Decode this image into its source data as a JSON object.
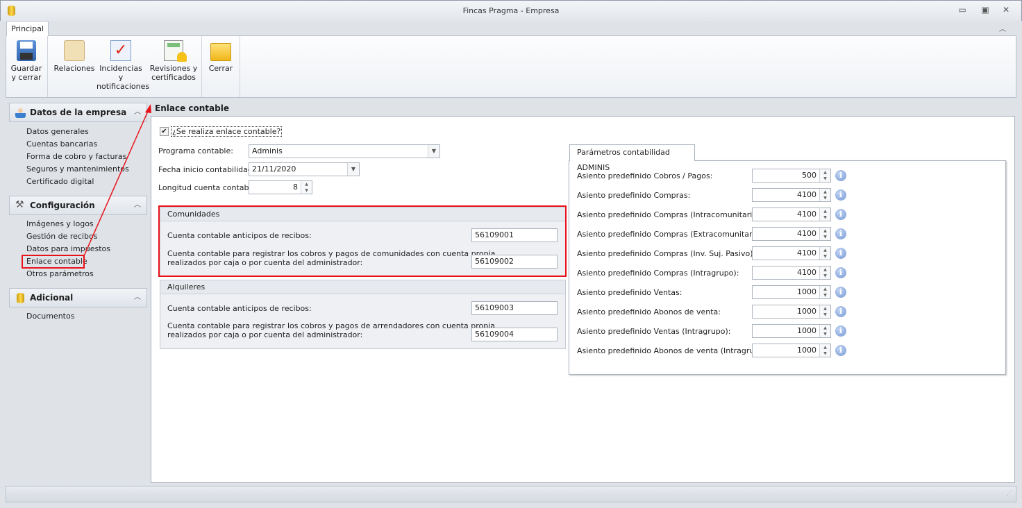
{
  "window": {
    "title": "Fincas Pragma - Empresa",
    "min": "▭",
    "max": "▣",
    "close": "✕",
    "collapse": "︿"
  },
  "ribbon": {
    "tab": "Principal",
    "buttons": [
      {
        "id": "guardar",
        "l1": "Guardar",
        "l2": "y cerrar",
        "icon": "floppy-disk-icon"
      },
      {
        "id": "relaciones",
        "l1": "Relaciones",
        "l2": "",
        "icon": "contact-cards-icon"
      },
      {
        "id": "incidencias",
        "l1": "Incidencias y",
        "l2": "notificaciones",
        "icon": "mail-check-icon"
      },
      {
        "id": "revisiones",
        "l1": "Revisiones y",
        "l2": "certificados",
        "icon": "notebook-bell-icon"
      },
      {
        "id": "cerrar",
        "l1": "Cerrar",
        "l2": "",
        "icon": "folder-arrow-icon"
      }
    ]
  },
  "sidebar": {
    "groups": [
      {
        "title": "Datos de la empresa",
        "items": [
          "Datos generales",
          "Cuentas bancarias",
          "Forma de cobro y facturas",
          "Seguros y mantenimientos",
          "Certificado digital"
        ]
      },
      {
        "title": "Configuración",
        "items": [
          "Imágenes y logos",
          "Gestión de recibos",
          "Datos para impuestos",
          "Enlace contable",
          "Otros parámetros"
        ]
      },
      {
        "title": "Adicional",
        "items": [
          "Documentos"
        ]
      }
    ]
  },
  "main": {
    "title": "Enlace contable",
    "checkbox": {
      "label": "¿Se realiza enlace contable?",
      "checked": true
    },
    "programa": {
      "label": "Programa contable:",
      "value": "Adminis"
    },
    "fecha": {
      "label": "Fecha inicio contabilidad:",
      "value": "21/11/2020"
    },
    "longitud": {
      "label": "Longitud cuenta contable:",
      "value": "8"
    },
    "comunidades": {
      "title": "Comunidades",
      "l1": "Cuenta contable anticipos de recibos:",
      "v1": "56109001",
      "l2a": "Cuenta contable para registrar los cobros y pagos de comunidades con cuenta propia",
      "l2b": "realizados por caja o por cuenta del administrador:",
      "v2": "56109002"
    },
    "alquileres": {
      "title": "Alquileres",
      "l1": "Cuenta contable anticipos de recibos:",
      "v1": "56109003",
      "l2a": "Cuenta contable para registrar los cobros y pagos de arrendadores con cuenta propia",
      "l2b": "realizados por caja o por cuenta del administrador:",
      "v2": "56109004"
    }
  },
  "params": {
    "tab": "Parámetros contabilidad ADMINIS",
    "info": "i",
    "rows": [
      {
        "label": "Asiento  predefinido Cobros / Pagos:",
        "value": "500"
      },
      {
        "label": "Asiento  predefinido Compras:",
        "value": "4100"
      },
      {
        "label": "Asiento  predefinido Compras (Intracomunitarias):",
        "value": "4100"
      },
      {
        "label": "Asiento  predefinido Compras (Extracomunitarias):",
        "value": "4100"
      },
      {
        "label": "Asiento  predefinido Compras (Inv. Suj. Pasivo):",
        "value": "4100"
      },
      {
        "label": "Asiento  predefinido Compras (Intragrupo):",
        "value": "4100"
      },
      {
        "label": "Asiento  predefinido Ventas:",
        "value": "1000"
      },
      {
        "label": "Asiento  predefinido Abonos de venta:",
        "value": "1000"
      },
      {
        "label": "Asiento  predefinido Ventas (Intragrupo):",
        "value": "1000"
      },
      {
        "label": "Asiento  predefinido Abonos de venta (Intragrupo):",
        "value": "1000"
      }
    ]
  }
}
